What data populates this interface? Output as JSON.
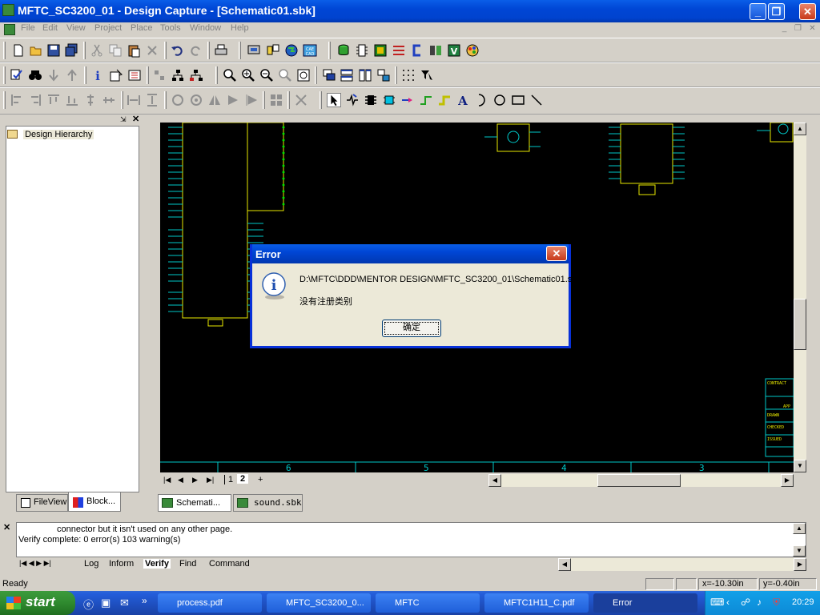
{
  "window": {
    "title": "MFTC_SC3200_01 - Design Capture - [Schematic01.sbk]"
  },
  "menu": [
    "File",
    "Edit",
    "View",
    "Project",
    "Place",
    "Tools",
    "Window",
    "Help"
  ],
  "left_panel": {
    "tree_root": "Design Hierarchy",
    "tabs": [
      "FileView",
      "Block..."
    ]
  },
  "sheet_tabs": [
    "1",
    "2",
    "+"
  ],
  "doc_tabs": [
    "Schemati...",
    "sound.sbk"
  ],
  "ruler_numbers": [
    "6",
    "5",
    "4",
    "3"
  ],
  "title_block": [
    "CONTRACT",
    "APP",
    "DRAWN",
    "CHECKED",
    "ISSUED"
  ],
  "output": {
    "lines": [
      "connector but it isn't used on any other page.",
      "Verify complete: 0 error(s) 103 warning(s)"
    ],
    "tabs": [
      "Log",
      "Inform",
      "Verify",
      "Find",
      "Command"
    ],
    "active_tab": "Verify"
  },
  "status": {
    "text": "Ready",
    "x": "x=-10.30in",
    "y": "y=-0.40in"
  },
  "dialog": {
    "title": "Error",
    "path": "D:\\MFTC\\DDD\\MENTOR DESIGN\\MFTC_SC3200_01\\Schematic01.sbk",
    "message": "没有注册类别",
    "ok_label": "确定"
  },
  "taskbar": {
    "start_label": "start",
    "tasks": [
      "process.pdf",
      "MFTC_SC3200_0...",
      "MFTC",
      "MFTC1H11_C.pdf",
      "Error"
    ],
    "clock": "20:29"
  },
  "colors": {
    "schematic_bg": "#000000",
    "wire": "#00c8c8",
    "part": "#e8e800",
    "xp_blue": "#0046d5"
  }
}
